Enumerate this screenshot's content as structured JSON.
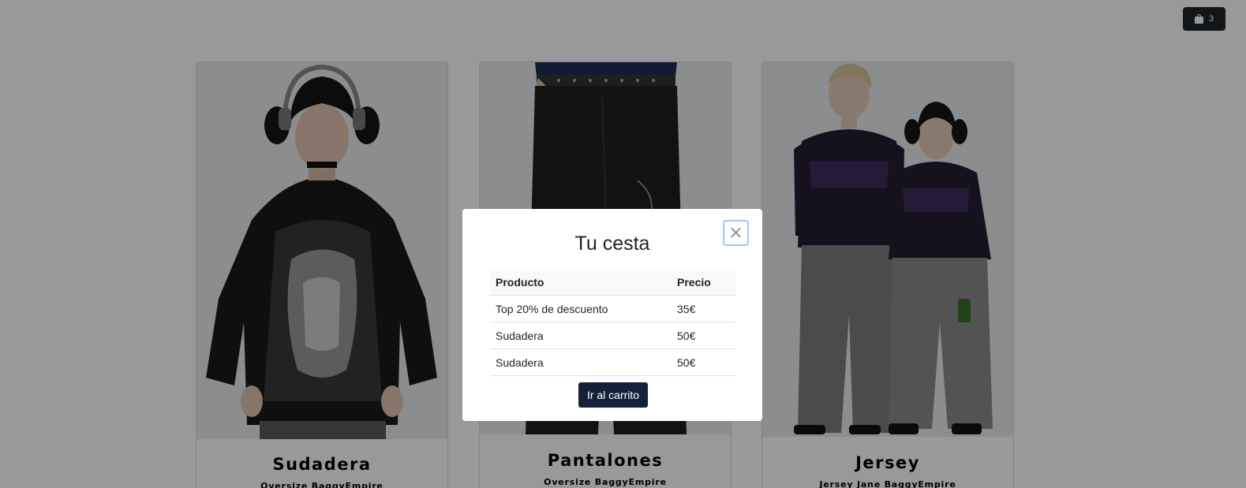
{
  "header": {
    "cart_count": "3"
  },
  "products": [
    {
      "title": "Sudadera",
      "subtitle": "Oversize BaggyEmpire"
    },
    {
      "title": "Pantalones",
      "subtitle": "Oversize BaggyEmpire"
    },
    {
      "title": "Jersey",
      "subtitle": "Jersey Jane BaggyEmpire"
    }
  ],
  "modal": {
    "close_glyph": "×",
    "title": "Tu cesta",
    "columns": [
      "Producto",
      "Precio"
    ],
    "rows": [
      {
        "product": "Top 20% de descuento",
        "price": "35€"
      },
      {
        "product": "Sudadera",
        "price": "50€"
      },
      {
        "product": "Sudadera",
        "price": "50€"
      }
    ],
    "button_label": "Ir al carrito"
  },
  "colors": {
    "cart_button": "#212529",
    "primary_button": "#15213b",
    "overlay": "rgba(0,0,0,0.4)"
  }
}
